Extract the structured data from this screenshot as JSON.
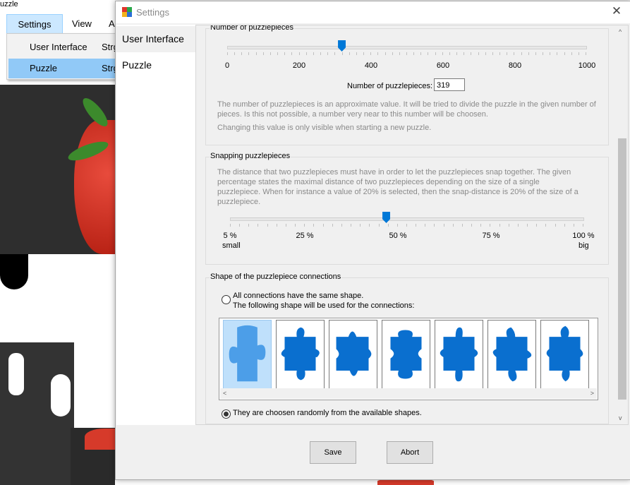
{
  "main_app": {
    "title": "uzzle",
    "menu": [
      "Settings",
      "View",
      "A"
    ],
    "dropdown_items": [
      {
        "label": "User Interface",
        "shortcut": "Strg"
      },
      {
        "label": "Puzzle",
        "shortcut": "Strg"
      }
    ]
  },
  "dialog": {
    "title": "Settings",
    "nav": [
      "User Interface",
      "Puzzle"
    ],
    "pieces": {
      "group_title": "Number of puzzlepieces",
      "tick_labels": [
        "0",
        "200",
        "400",
        "600",
        "800",
        "1000"
      ],
      "range": [
        0,
        1000
      ],
      "field_label": "Number of puzzlepieces:",
      "value": "319",
      "desc1": "The number of puzzlepieces is an approximate value. It will be tried to divide the puzzle in the given number of pieces. Is this not possible, a number very near to this number will be choosen.",
      "desc2": "Changing this value is only visible when starting a new puzzle."
    },
    "snapping": {
      "group_title": "Snapping puzzlepieces",
      "desc": "The distance that two puzzlepieces must have in order to let the puzzlepieces snap together. The given percentage states the maximal distance of two puzzlepieces depending on the size of a single puzzlepiece. When for instance a value of 20% is selected, then the snap-distance is 20% of the size of a puzzlepiece.",
      "tick_labels": [
        "5 %",
        "25 %",
        "50 %",
        "75 %",
        "100 %"
      ],
      "min_caption": "small",
      "max_caption": "big",
      "value_percent": 47
    },
    "shape": {
      "group_title": "Shape of the puzzlepiece connections",
      "option1_line1": "All connections have the same shape.",
      "option1_line2": "The following shape will be used for the connections:",
      "option2": "They are choosen randomly from the available shapes.",
      "selected_option": 2,
      "shape_count": 7,
      "selected_shape": 0,
      "shape_color": "#0a6fcf"
    },
    "buttons": {
      "save": "Save",
      "abort": "Abort"
    }
  }
}
